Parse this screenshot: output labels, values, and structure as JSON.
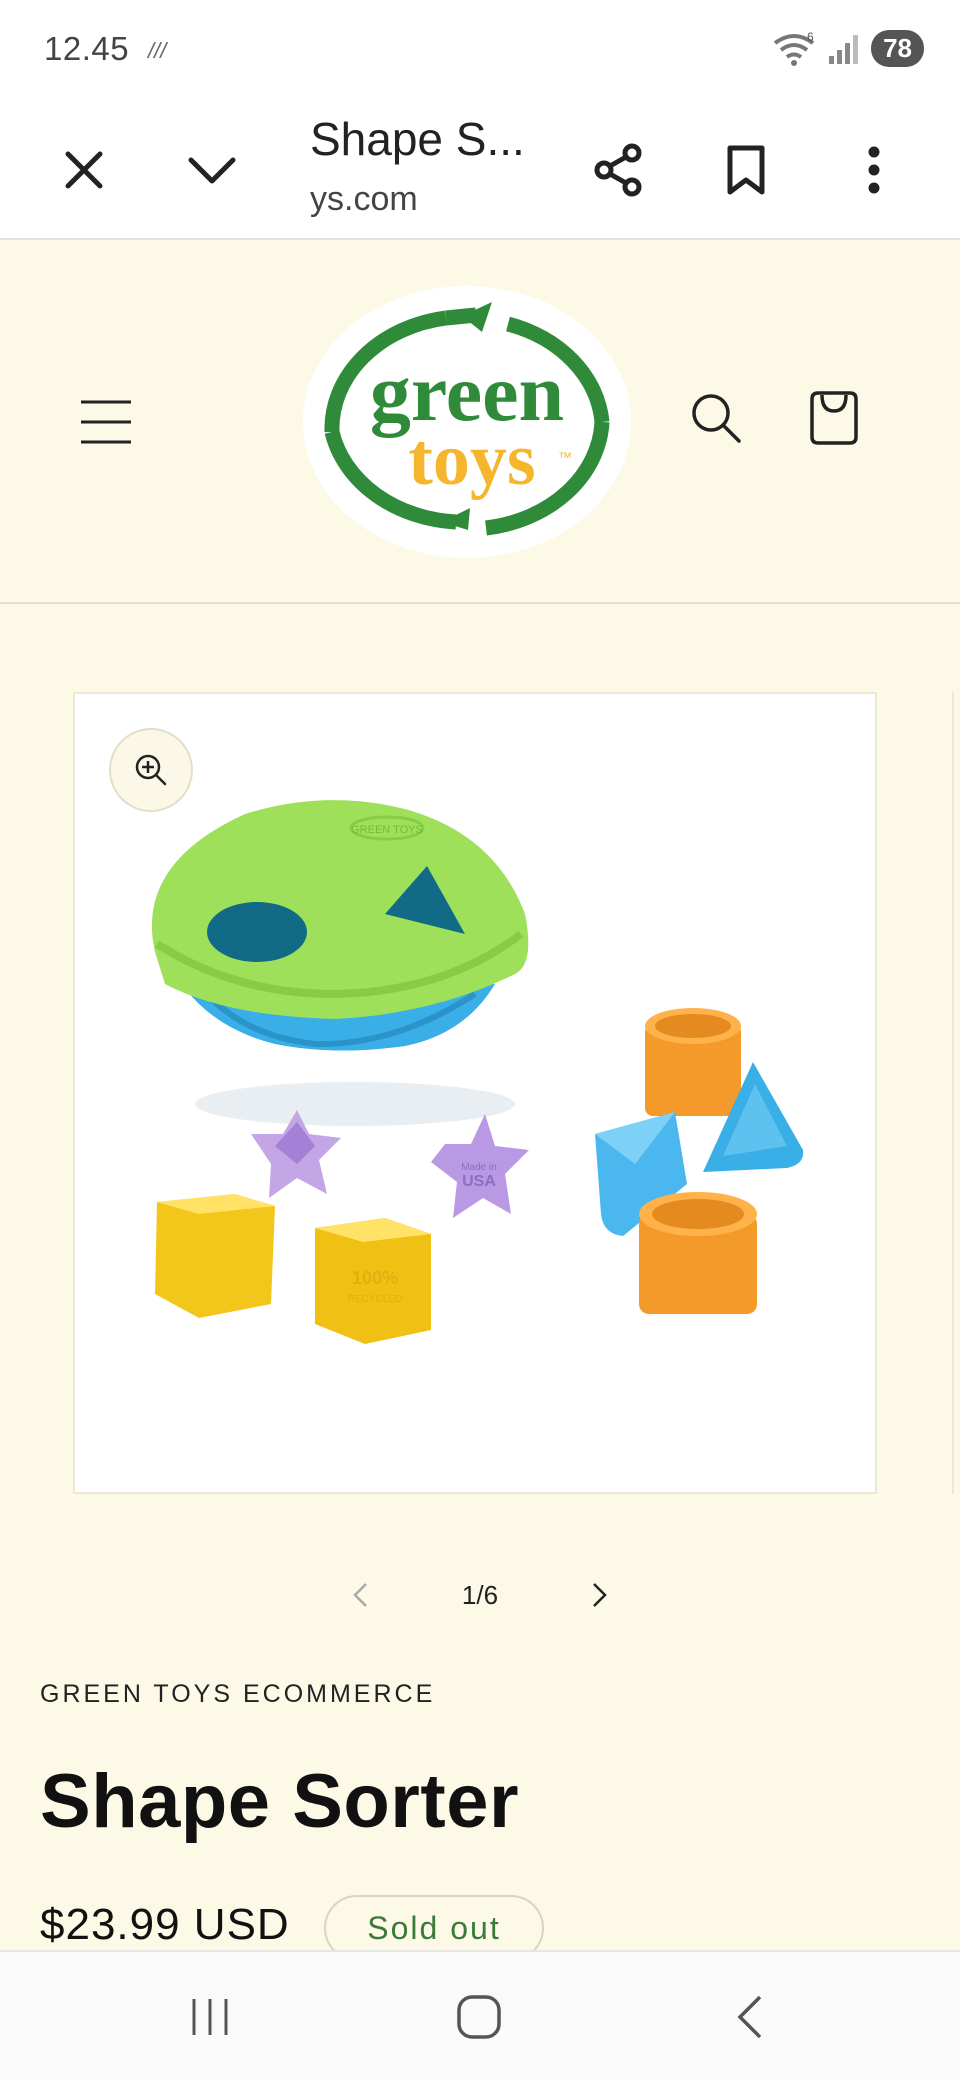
{
  "status_bar": {
    "time": "12.45",
    "network_glyph": "///",
    "wifi_badge": "6",
    "battery": "78",
    "icons": [
      "wifi-icon",
      "signal-icon",
      "battery-icon"
    ]
  },
  "browser": {
    "page_title": "Shape S...",
    "url": "ys.com",
    "buttons": [
      "close-icon",
      "chevron-down-icon",
      "share-icon",
      "bookmark-icon",
      "more-vert-icon"
    ]
  },
  "header": {
    "logo_top": "green",
    "logo_bottom": "toys",
    "logo_tm": "™",
    "icons": [
      "menu-icon",
      "search-icon",
      "cart-icon"
    ]
  },
  "gallery": {
    "current": "1/6",
    "zoom_icon": "zoom-in-icon",
    "product_image_text": {
      "lid_emboss": "GREEN TOYS",
      "star_emboss": "USA",
      "star_emboss_top": "Made in",
      "cube_emboss": "100%",
      "cube_emboss_sub": "RECYCLED"
    }
  },
  "product": {
    "vendor": "GREEN TOYS ECOMMERCE",
    "title": "Shape Sorter",
    "price": "$23.99 USD",
    "badge": "Sold out"
  },
  "colors": {
    "page_bg": "#fdf9e7",
    "logo_green": "#2f8b3a",
    "logo_orange": "#f5b52c",
    "badge_text": "#3a7b3c"
  },
  "nav_bar": {
    "buttons": [
      "recents-icon",
      "home-icon",
      "back-icon"
    ]
  }
}
